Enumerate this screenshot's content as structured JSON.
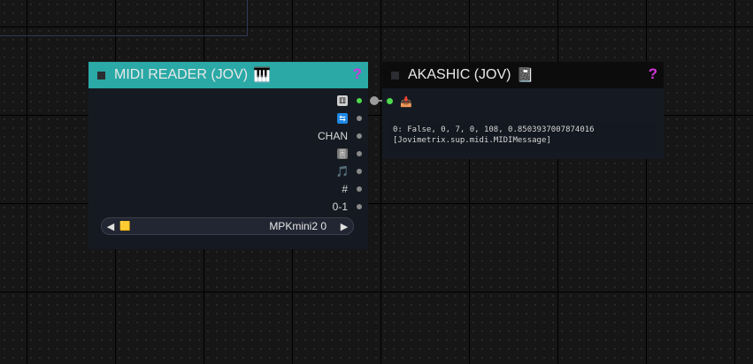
{
  "midi_reader": {
    "title": "MIDI READER (JOV)",
    "title_icon": "🎹",
    "help": "?",
    "outputs": [
      {
        "name": "output-trigger",
        "icon": "dice-icon",
        "glyph": "⚅",
        "label": "",
        "color": "#cccccc",
        "active": true
      },
      {
        "name": "output-on",
        "icon": "toggle-icon",
        "glyph": "⇆",
        "label": "",
        "color": "#1e88e5",
        "active": false
      },
      {
        "name": "output-chan",
        "icon": "",
        "glyph": "",
        "label": "CHAN",
        "color": "",
        "active": false
      },
      {
        "name": "output-control",
        "icon": "fader-icon",
        "glyph": "🎚",
        "label": "",
        "color": "#bbbbbb",
        "active": false
      },
      {
        "name": "output-note",
        "icon": "music-note-icon",
        "glyph": "🎵",
        "label": "",
        "color": "#9b59ff",
        "active": false
      },
      {
        "name": "output-number",
        "icon": "",
        "glyph": "",
        "label": "#",
        "color": "",
        "active": false
      },
      {
        "name": "output-normalized",
        "icon": "",
        "glyph": "",
        "label": "0-1",
        "color": "",
        "active": false
      }
    ],
    "device": {
      "icon_glyph": "🟨",
      "value": "MPKmini2 0",
      "left_arrow": "◀",
      "right_arrow": "▶"
    }
  },
  "akashic": {
    "title": "AKASHIC (JOV)",
    "title_icon": "📓",
    "help": "?",
    "input_icon": "📥",
    "text_lines": [
      "0: False, 0, 7, 0, 108, 0.8503937007874016",
      "[Jovimetrix.sup.midi.MIDIMessage]"
    ]
  }
}
